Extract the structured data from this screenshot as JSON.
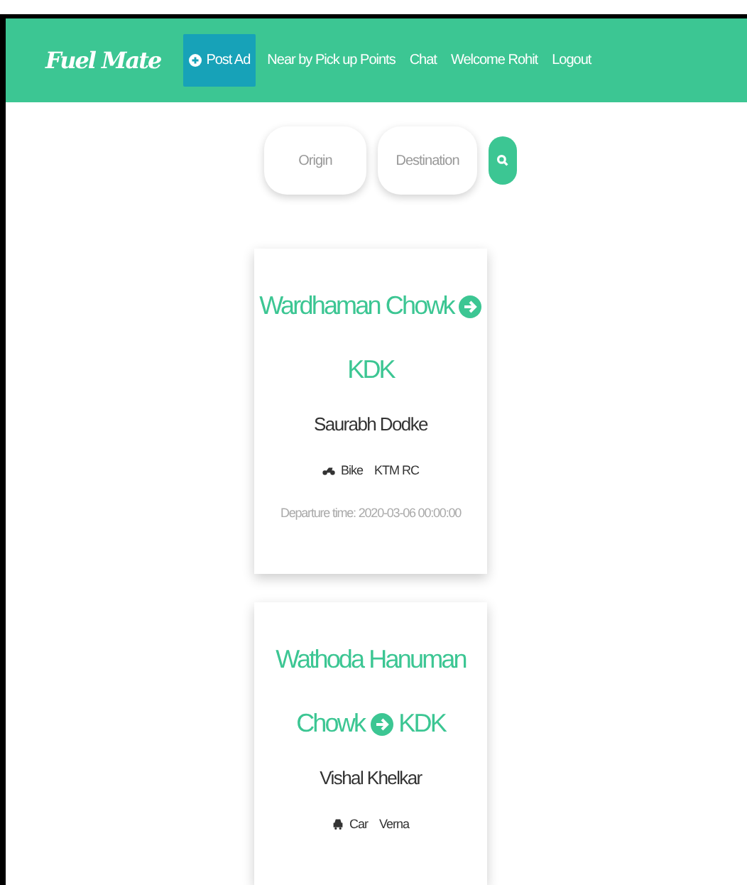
{
  "navbar": {
    "brand": "Fuel Mate",
    "items": [
      {
        "label": "Post Ad",
        "selected": true,
        "icon": true
      },
      {
        "label": "Near by Pick up Points",
        "selected": false,
        "icon": false
      },
      {
        "label": "Chat",
        "selected": false,
        "icon": false
      },
      {
        "label": "Welcome Rohit",
        "selected": false,
        "icon": false
      },
      {
        "label": "Logout",
        "selected": false,
        "icon": false
      }
    ]
  },
  "search": {
    "origin": {
      "placeholder": "Origin"
    },
    "destination": {
      "placeholder": "Destination"
    }
  },
  "rides": [
    {
      "from": "Wardhaman Chowk",
      "to": "KDK",
      "driver": "Saurabh Dodke",
      "vehicle": {
        "kind": "bike",
        "type": "Bike",
        "model": "KTM RC"
      },
      "departure": "Departure time: 2020-03-06 00:00:00"
    },
    {
      "from": "Wathoda Hanuman Chowk",
      "to": "KDK",
      "driver": "Vishal Khelkar",
      "vehicle": {
        "kind": "car",
        "type": "Car",
        "model": "Verna"
      }
    }
  ]
}
